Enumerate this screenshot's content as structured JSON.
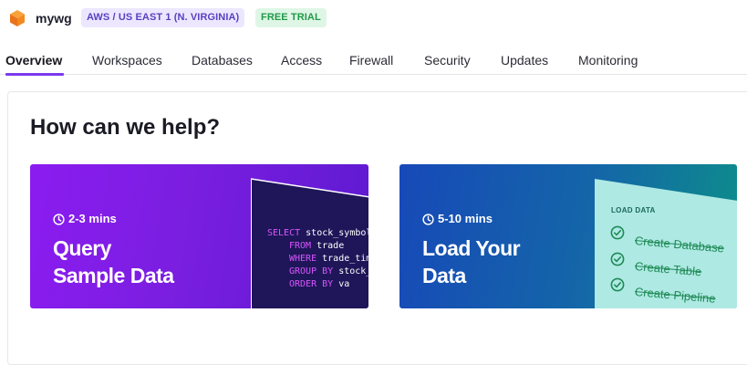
{
  "header": {
    "workspace_name": "mywg",
    "region_badge": "AWS / US EAST 1 (N. VIRGINIA)",
    "trial_badge": "FREE TRIAL"
  },
  "tabs": [
    {
      "label": "Overview",
      "active": true
    },
    {
      "label": "Workspaces"
    },
    {
      "label": "Databases"
    },
    {
      "label": "Access"
    },
    {
      "label": "Firewall"
    },
    {
      "label": "Security"
    },
    {
      "label": "Updates"
    },
    {
      "label": "Monitoring"
    }
  ],
  "main": {
    "title": "How can we help?",
    "cards": [
      {
        "time": "2-3 mins",
        "title_line1": "Query",
        "title_line2": "Sample Data",
        "code": [
          {
            "kw": "SELECT",
            "text": "stock_symbol"
          },
          {
            "kw": "FROM",
            "text": "trade"
          },
          {
            "kw": "WHERE",
            "text": "trade_time"
          },
          {
            "kw": "GROUP BY",
            "text": "stock_sy"
          },
          {
            "kw": "ORDER BY",
            "text": "va"
          }
        ]
      },
      {
        "time": "5-10 mins",
        "title_line1": "Load Your",
        "title_line2": "Data",
        "panel_heading": "LOAD DATA",
        "steps": [
          "Create Database",
          "Create Table",
          "Create Pipeline"
        ]
      }
    ]
  },
  "colors": {
    "accent": "#7c3aed",
    "query_card": "#8b1cf0",
    "load_card": "#1749b8",
    "trial_green": "#1f9a48"
  },
  "icons": {
    "logo": "cube-logo-icon",
    "clock": "clock-icon",
    "check": "check-circle-icon"
  }
}
